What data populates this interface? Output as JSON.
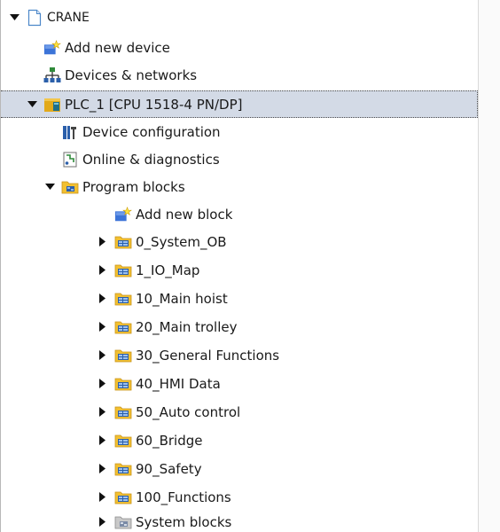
{
  "tree": {
    "project": {
      "label": "CRANE"
    },
    "add_device": {
      "label": "Add new device"
    },
    "devices_networks": {
      "label": "Devices & networks"
    },
    "plc": {
      "label": "PLC_1 [CPU 1518-4 PN/DP]"
    },
    "device_config": {
      "label": "Device configuration"
    },
    "online_diag": {
      "label": "Online & diagnostics"
    },
    "program_blocks": {
      "label": "Program blocks"
    },
    "add_block": {
      "label": "Add new block"
    },
    "groups": [
      {
        "label": "0_System_OB"
      },
      {
        "label": "1_IO_Map"
      },
      {
        "label": "10_Main hoist"
      },
      {
        "label": "20_Main trolley"
      },
      {
        "label": "30_General Functions"
      },
      {
        "label": "40_HMI Data"
      },
      {
        "label": "50_Auto control"
      },
      {
        "label": "60_Bridge"
      },
      {
        "label": "90_Safety"
      },
      {
        "label": "100_Functions"
      }
    ],
    "system_blocks": {
      "label": "System blocks"
    }
  },
  "icons": {
    "project": "project-page-icon",
    "add": "add-new-star-icon",
    "network": "network-topology-icon",
    "plc": "plc-cpu-icon",
    "device_config": "device-configuration-icon",
    "online_diag": "online-diagnostics-icon",
    "program_blocks": "program-blocks-folder-icon",
    "group_folder": "block-group-folder-icon",
    "system_blocks": "system-blocks-folder-icon"
  },
  "colors": {
    "selection_bg": "#d3dae6",
    "folder_yellow": "#f2c031",
    "add_blue": "#3c74d8",
    "add_star": "#ffe23c"
  }
}
